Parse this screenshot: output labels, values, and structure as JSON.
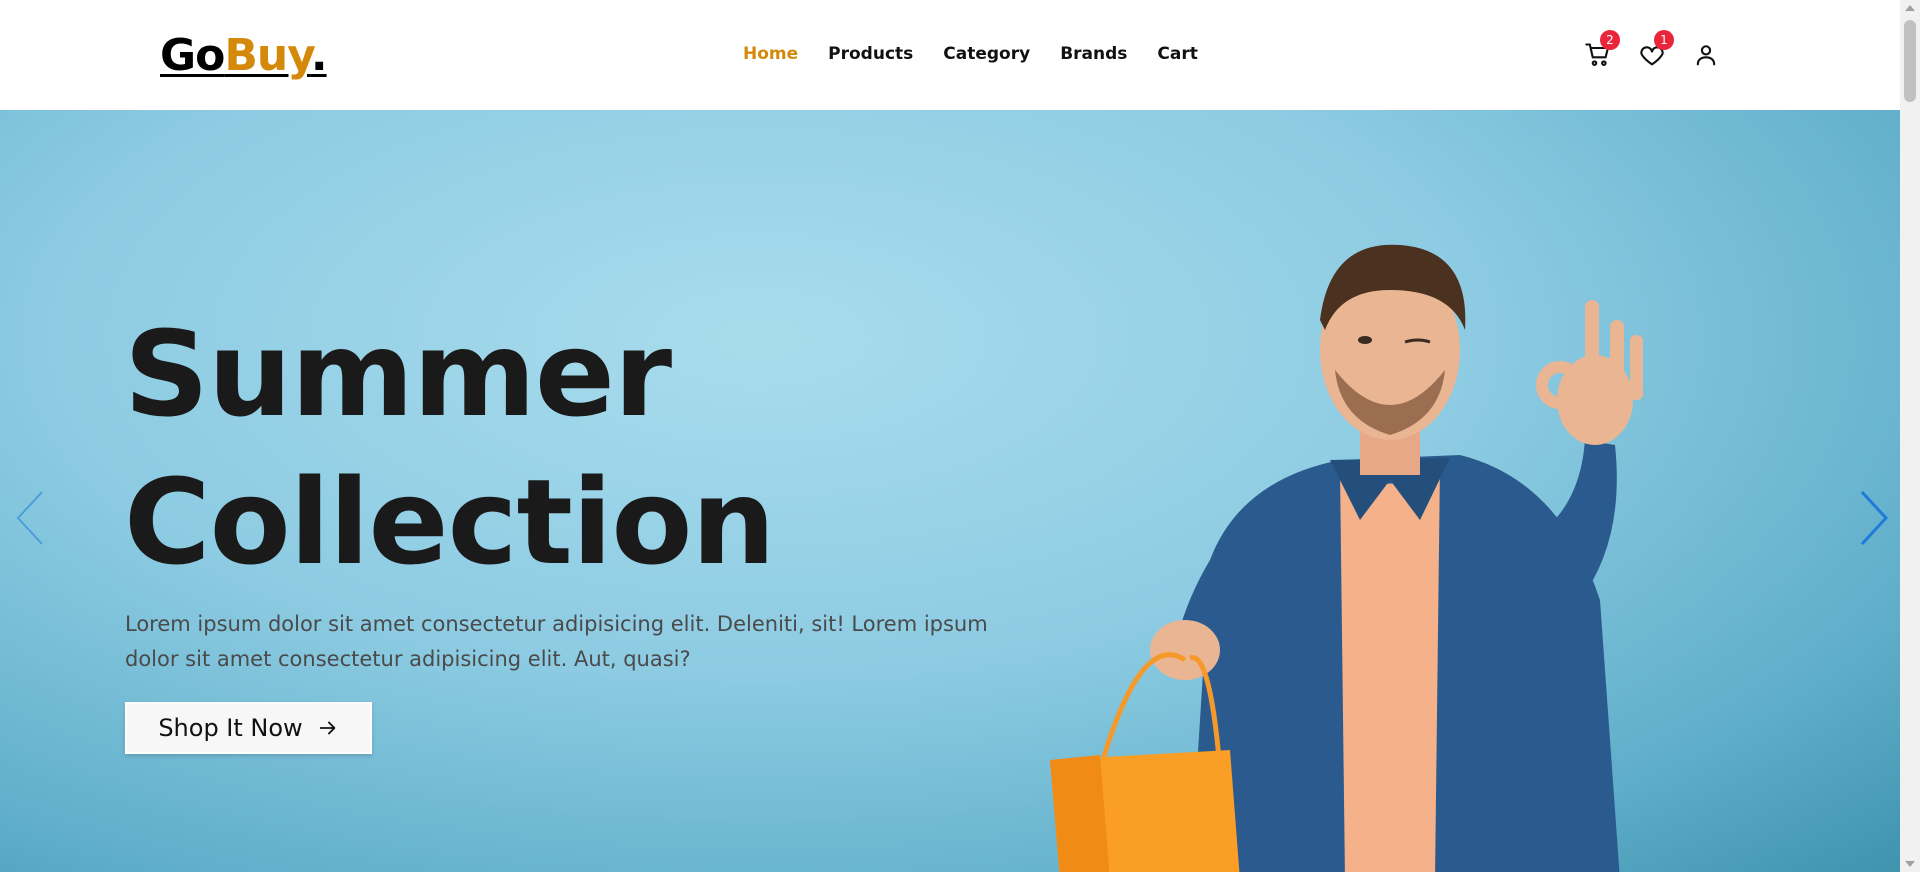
{
  "brand": {
    "part1": "Go",
    "part2": "Buy",
    "part3": "."
  },
  "nav": {
    "links": [
      {
        "label": "Home",
        "active": true
      },
      {
        "label": "Products",
        "active": false
      },
      {
        "label": "Category",
        "active": false
      },
      {
        "label": "Brands",
        "active": false
      },
      {
        "label": "Cart",
        "active": false
      }
    ]
  },
  "icons": {
    "cart": {
      "name": "cart-icon",
      "badge": "2"
    },
    "wishlist": {
      "name": "heart-icon",
      "badge": "1"
    },
    "account": {
      "name": "user-icon"
    }
  },
  "hero": {
    "title_line1": "Summer",
    "title_line2": "Collection",
    "text": "Lorem ipsum dolor sit amet consectetur adipisicing elit. Deleniti, sit! Lorem ipsum dolor sit amet consectetur adipisicing elit. Aut, quasi?",
    "cta_label": "Shop It Now",
    "prev_icon": "chevron-left-icon",
    "next_icon": "chevron-right-icon"
  },
  "colors": {
    "accent": "#d4890a",
    "badge": "#e8253a",
    "hero_bg": "#8ccbe2",
    "arrow": "#1e7bd8"
  }
}
